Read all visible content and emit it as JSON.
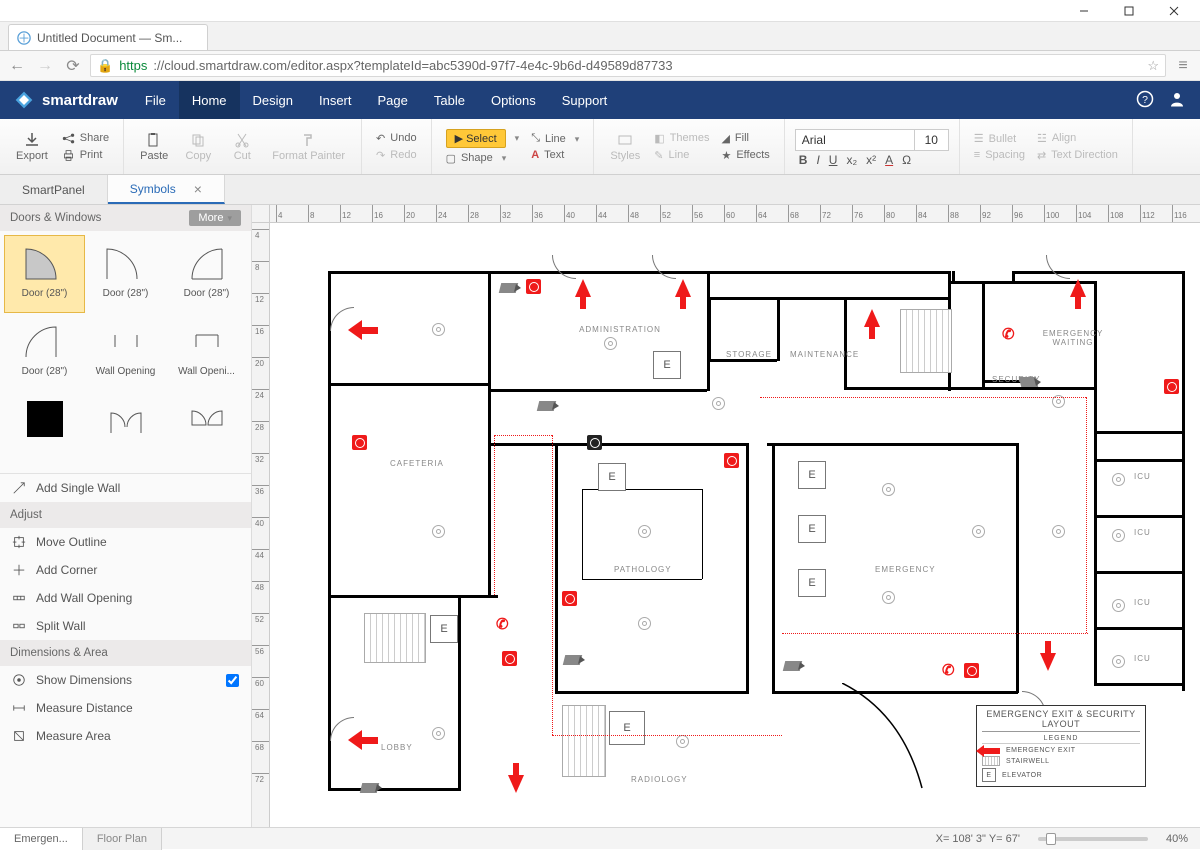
{
  "window": {
    "title": "Untitled Document — Sm..."
  },
  "browser": {
    "tab_title": "Untitled Document — Sm...",
    "url_proto": "https",
    "url_path": "://cloud.smartdraw.com/editor.aspx?templateId=abc5390d-97f7-4e4c-9b6d-d49589d87733"
  },
  "brand": "smartdraw",
  "menu": {
    "items": [
      "File",
      "Home",
      "Design",
      "Insert",
      "Page",
      "Table",
      "Options",
      "Support"
    ],
    "active": "Home"
  },
  "ribbon": {
    "export": "Export",
    "share": "Share",
    "print": "Print",
    "paste": "Paste",
    "copy": "Copy",
    "cut": "Cut",
    "format_painter": "Format Painter",
    "undo": "Undo",
    "redo": "Redo",
    "select": "Select",
    "shape": "Shape",
    "line": "Line",
    "text": "Text",
    "styles": "Styles",
    "themes": "Themes",
    "line2": "Line",
    "fill": "Fill",
    "effects": "Effects",
    "font_name": "Arial",
    "font_size": "10",
    "bullet": "Bullet",
    "spacing": "Spacing",
    "align": "Align",
    "text_direction": "Text Direction"
  },
  "panel_tabs": {
    "smartpanel": "SmartPanel",
    "symbols": "Symbols"
  },
  "sidebar": {
    "doors_header": "Doors & Windows",
    "more": "More",
    "symbols": [
      {
        "label": "Door (28\")"
      },
      {
        "label": "Door (28\")"
      },
      {
        "label": "Door (28\")"
      },
      {
        "label": "Door (28\")"
      },
      {
        "label": "Wall Opening"
      },
      {
        "label": "Wall Openi..."
      }
    ],
    "add_single_wall": "Add Single Wall",
    "adjust_header": "Adjust",
    "move_outline": "Move Outline",
    "add_corner": "Add Corner",
    "add_wall_opening": "Add Wall Opening",
    "split_wall": "Split Wall",
    "dimensions_header": "Dimensions & Area",
    "show_dimensions": "Show Dimensions",
    "measure_distance": "Measure Distance",
    "measure_area": "Measure Area"
  },
  "canvas": {
    "ruler_h": [
      "4",
      "8",
      "12",
      "16",
      "20",
      "24",
      "28",
      "32",
      "36",
      "40",
      "44",
      "48",
      "52",
      "56",
      "60",
      "64",
      "68",
      "72",
      "76",
      "80",
      "84",
      "88",
      "92",
      "96",
      "100",
      "104",
      "108",
      "112",
      "116"
    ],
    "ruler_v": [
      "4",
      "8",
      "12",
      "16",
      "20",
      "24",
      "28",
      "32",
      "36",
      "40",
      "44",
      "48",
      "52",
      "56",
      "60",
      "64",
      "68",
      "72"
    ]
  },
  "rooms": {
    "administration": "ADMINISTRATION",
    "storage": "STORAGE",
    "maintenance": "MAINTENANCE",
    "security": "SECURITY",
    "emergency_waiting": "EMERGENCY WAITING",
    "cafeteria": "CAFETERIA",
    "pathology": "PATHOLOGY",
    "emergency": "EMERGENCY",
    "icu": "ICU",
    "lobby": "LOBBY",
    "radiology": "RADIOLOGY",
    "e_label": "E"
  },
  "legend": {
    "title": "EMERGENCY EXIT & SECURITY LAYOUT",
    "sub": "LEGEND",
    "emergency_exit": "EMERGENCY EXIT",
    "stairwell": "STAIRWELL",
    "elevator": "ELEVATOR"
  },
  "status": {
    "sheet_active": "Emergen...",
    "sheet_inactive": "Floor Plan",
    "coords": "X= 108' 3\"  Y= 67'",
    "zoom": "40%"
  }
}
